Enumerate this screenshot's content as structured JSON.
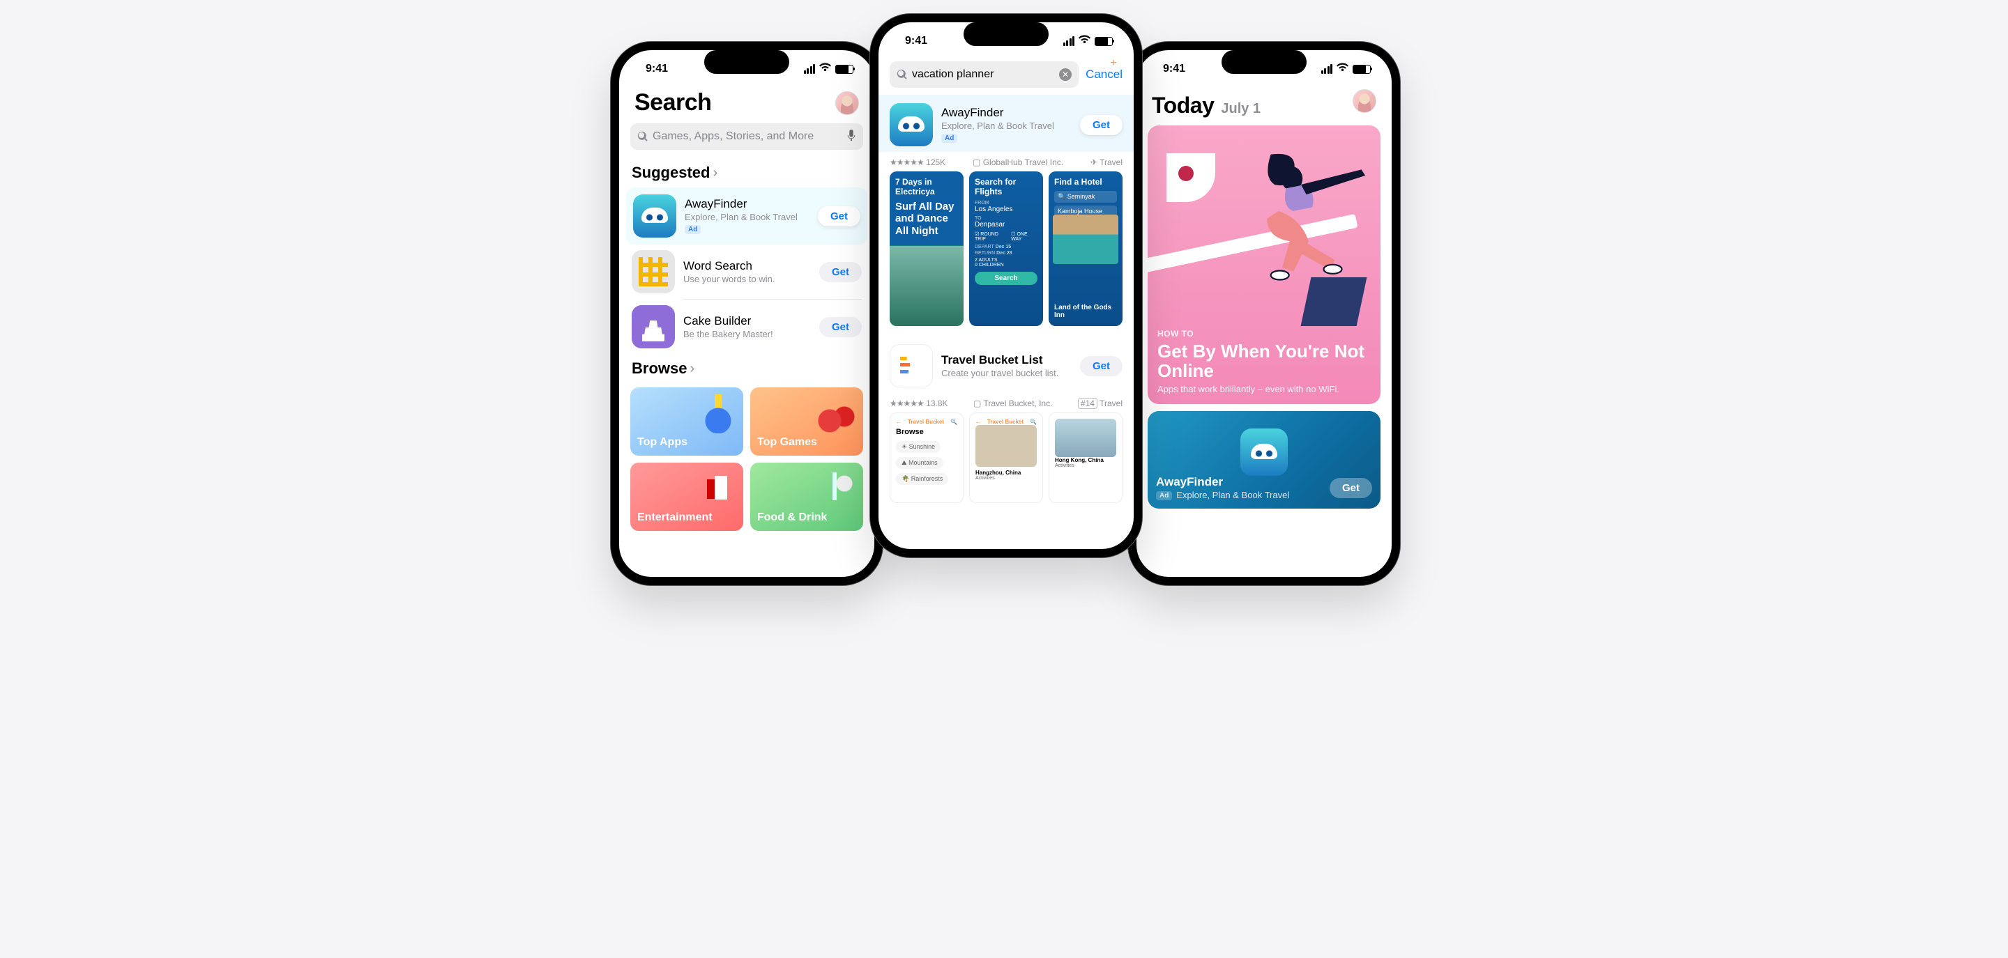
{
  "status": {
    "time": "9:41"
  },
  "left": {
    "title": "Search",
    "search_placeholder": "Games, Apps, Stories, and More",
    "suggested_heading": "Suggested",
    "browse_heading": "Browse",
    "apps": [
      {
        "name": "AwayFinder",
        "desc": "Explore, Plan & Book Travel",
        "ad": "Ad",
        "get": "Get"
      },
      {
        "name": "Word Search",
        "desc": "Use your words to win.",
        "get": "Get"
      },
      {
        "name": "Cake Builder",
        "desc": "Be the Bakery Master!",
        "get": "Get"
      }
    ],
    "tiles": [
      "Top Apps",
      "Top Games",
      "Entertainment",
      "Food & Drink"
    ]
  },
  "center": {
    "query": "vacation planner",
    "cancel": "Cancel",
    "result": {
      "name": "AwayFinder",
      "desc": "Explore, Plan & Book Travel",
      "ad": "Ad",
      "get": "Get",
      "rating": "★★★★★",
      "rating_count": "125K",
      "developer": "GlobalHub Travel Inc.",
      "category": "Travel",
      "shots": {
        "s1": {
          "title": "7 Days in Electricya",
          "title2": "Surf All Day and Dance All Night"
        },
        "s2": {
          "title": "Search for Flights",
          "from_lbl": "FROM",
          "from": "Los Angeles",
          "to_lbl": "TO",
          "to": "Denpasar",
          "rt": "ROUND TRIP",
          "ow": "ONE WAY",
          "depart_lbl": "DEPART",
          "depart": "Dec 15",
          "return_lbl": "RETURN",
          "return": "Dec 28",
          "adults": "2   ADULTS",
          "children": "0   CHILDREN",
          "btn": "Search"
        },
        "s3": {
          "title": "Find a Hotel",
          "q": "Seminyak",
          "h1": "Kamboja House",
          "h2": "Land of the Gods Inn"
        }
      }
    },
    "result2": {
      "name": "Travel Bucket List",
      "desc": "Create your travel bucket list.",
      "get": "Get",
      "rating": "★★★★★",
      "rating_count": "13.8K",
      "developer": "Travel Bucket, Inc.",
      "category": "Travel",
      "rank": "#14",
      "shots": {
        "hdr": "Travel Bucket",
        "browse": "Browse",
        "c1": "Sunshine",
        "c2": "Mountains",
        "c3": "Rainforests",
        "p1": "Hangzhou, China",
        "p2": "Hong Kong, China",
        "act": "Activities"
      }
    }
  },
  "right": {
    "title": "Today",
    "date": "July 1",
    "hero": {
      "eyebrow": "HOW TO",
      "title": "Get By When You're Not Online",
      "sub": "Apps that work brilliantly – even with no WiFi."
    },
    "banner": {
      "name": "AwayFinder",
      "ad": "Ad",
      "desc": "Explore, Plan & Book Travel",
      "get": "Get"
    }
  }
}
